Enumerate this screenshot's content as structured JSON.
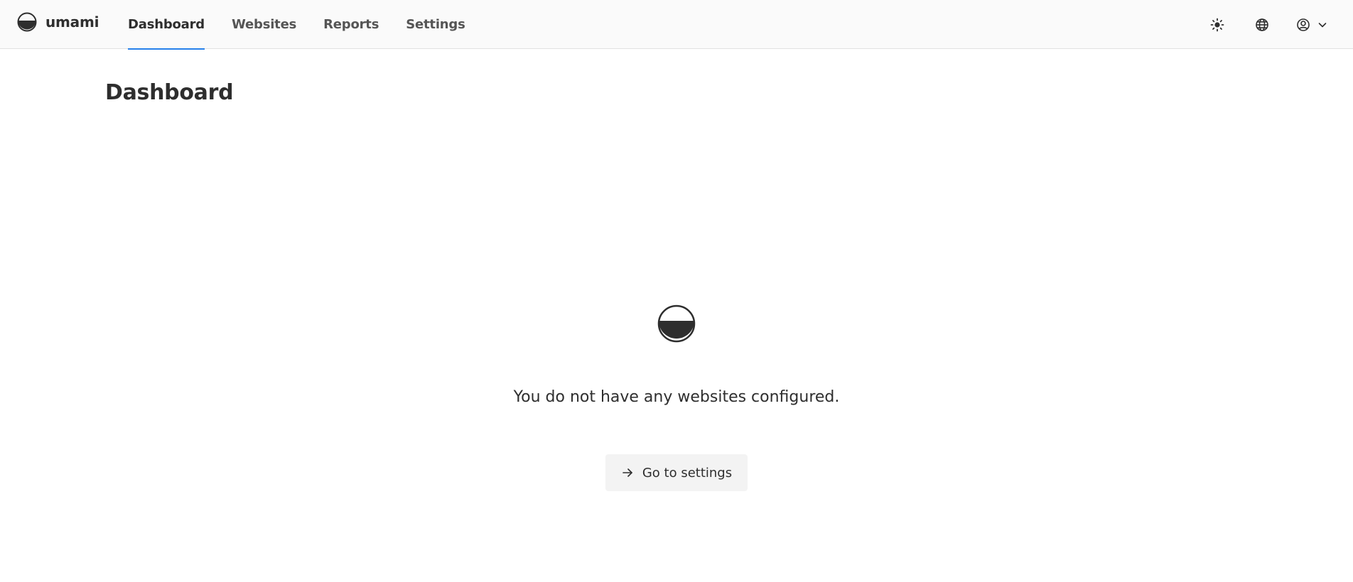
{
  "app": {
    "name": "umami"
  },
  "nav": {
    "items": [
      {
        "label": "Dashboard",
        "active": true
      },
      {
        "label": "Websites",
        "active": false
      },
      {
        "label": "Reports",
        "active": false
      },
      {
        "label": "Settings",
        "active": false
      }
    ]
  },
  "header_actions": {
    "icons": [
      "sun-icon",
      "globe-icon",
      "user-circle-icon",
      "chevron-down-icon"
    ]
  },
  "page": {
    "title": "Dashboard"
  },
  "empty_state": {
    "message": "You do not have any websites configured.",
    "button_label": "Go to settings",
    "button_icon": "arrow-right-icon"
  },
  "colors": {
    "accent": "#2680eb",
    "text": "#2e2e2e",
    "topbar_bg": "#fafafa",
    "button_bg": "#f3f3f3"
  }
}
